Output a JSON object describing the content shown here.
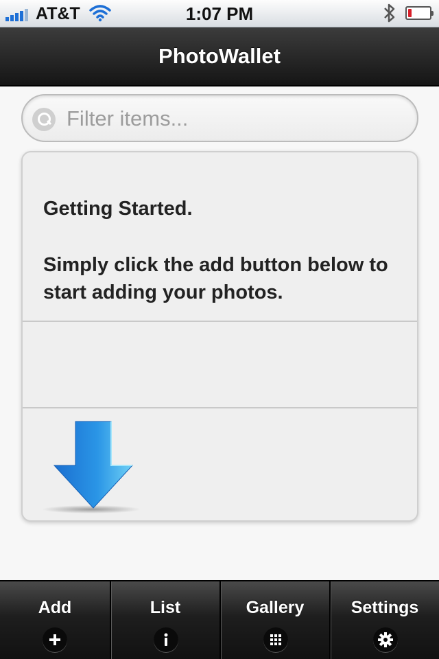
{
  "status_bar": {
    "carrier": "AT&T",
    "time": "1:07 PM",
    "signal_bars": 4,
    "battery_level": 0.15,
    "icons": [
      "signal-icon",
      "wifi-icon",
      "bluetooth-icon",
      "battery-icon"
    ]
  },
  "nav": {
    "title": "PhotoWallet"
  },
  "search": {
    "placeholder": "Filter items...",
    "value": ""
  },
  "card": {
    "heading": "Getting Started.",
    "body": "Simply click the add button below to start adding your photos.",
    "arrow_icon": "down-arrow-icon"
  },
  "tabs": [
    {
      "label": "Add",
      "icon": "plus-icon",
      "glyph": "+"
    },
    {
      "label": "List",
      "icon": "info-icon",
      "glyph": "i"
    },
    {
      "label": "Gallery",
      "icon": "grid-icon",
      "glyph": ""
    },
    {
      "label": "Settings",
      "icon": "gear-icon",
      "glyph": "⚙"
    }
  ],
  "colors": {
    "nav_background": "#1c1c1c",
    "tab_background": "#1e1e1e",
    "arrow_blue": "#1d7fd8",
    "signal_blue": "#1d6fd6",
    "battery_red": "#d8202a"
  }
}
